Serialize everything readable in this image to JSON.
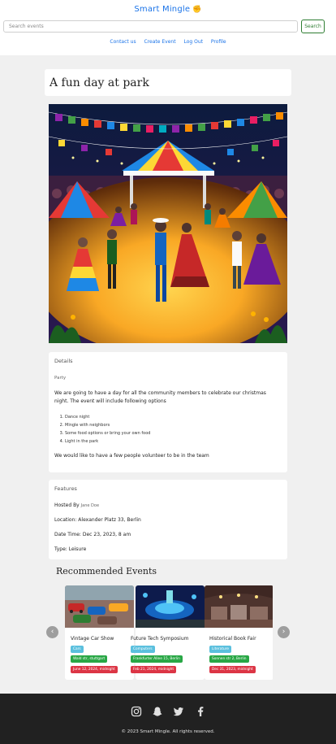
{
  "header": {
    "brand": "Smart Mingle",
    "search_placeholder": "Search events",
    "search_button": "Search",
    "nav": [
      "Contact us",
      "Create Event",
      "Log Out",
      "Profile"
    ]
  },
  "event": {
    "title": "A fun day at park",
    "details_label": "Details",
    "category": "Party",
    "description": "We are going to have a day for all the community members to celebrate our christmas night. The event will include following options",
    "steps": [
      "Dance night",
      "Mingle with neighbors",
      "Some food options or bring your own food",
      "Light in the park"
    ],
    "volunteer_text": "We would like to have a few people volunteer to be in the team"
  },
  "features": {
    "label": "Features",
    "hosted_by_label": "Hosted By",
    "host": "Jane Doe",
    "location": "Location: Alexander Platz 33, Berlin",
    "datetime": "Date Time: Dec 23, 2023, 8 am",
    "type": "Type: Leisure"
  },
  "recommended": {
    "heading": "Recommended Events",
    "events": [
      {
        "name": "Vintage Car Show",
        "category": "Cars",
        "location": "Wald str, stuttgart",
        "date": "June 12, 2024, midnight"
      },
      {
        "name": "Future Tech Symposium",
        "category": "Computers",
        "location": "Frankfurter Allee 15, Berlin",
        "date": "Feb 21, 2024, midnight"
      },
      {
        "name": "Historical Book Fair",
        "category": "Literature",
        "location": "Sonnen str 2, Berlin",
        "date": "Dec 31, 2023, midnight"
      }
    ]
  },
  "footer": {
    "copyright": "© 2023 Smart Mingle. All rights reserved."
  },
  "colors": {
    "link": "#1a73e8",
    "search_button": "#2e7d32",
    "badge_category": "#5bc0de",
    "badge_location": "#28a745",
    "badge_date": "#dc3545",
    "footer_bg": "#212121"
  }
}
